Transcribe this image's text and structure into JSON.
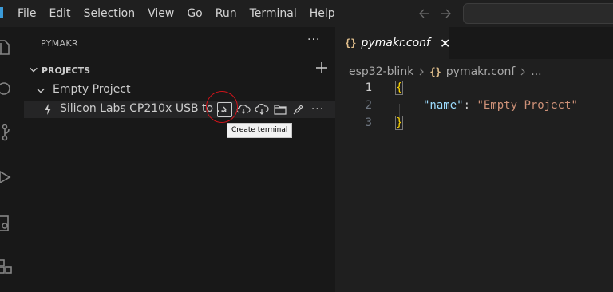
{
  "menu": [
    "File",
    "Edit",
    "Selection",
    "View",
    "Go",
    "Run",
    "Terminal",
    "Help"
  ],
  "sidebar": {
    "title": "PYMAKR",
    "more": "···",
    "section": "PROJECTS",
    "project": "Empty Project",
    "device": "Silicon Labs CP210x USB to ...",
    "tooltip": "Create terminal"
  },
  "editor": {
    "tab": {
      "icon": "{}",
      "label": "pymakr.conf",
      "close": "✕"
    },
    "breadcrumb": [
      "esp32-blink",
      "pymakr.conf",
      "..."
    ],
    "lines": [
      {
        "num": "1",
        "open": "{"
      },
      {
        "num": "2",
        "key": "\"name\"",
        "colon": ": ",
        "value": "\"Empty Project\""
      },
      {
        "num": "3",
        "close": "}"
      }
    ]
  },
  "colors": {
    "accent": "#3b9bd9",
    "annotation": "#d0141b",
    "json_key": "#9cdcfe",
    "json_string": "#ce9178"
  }
}
